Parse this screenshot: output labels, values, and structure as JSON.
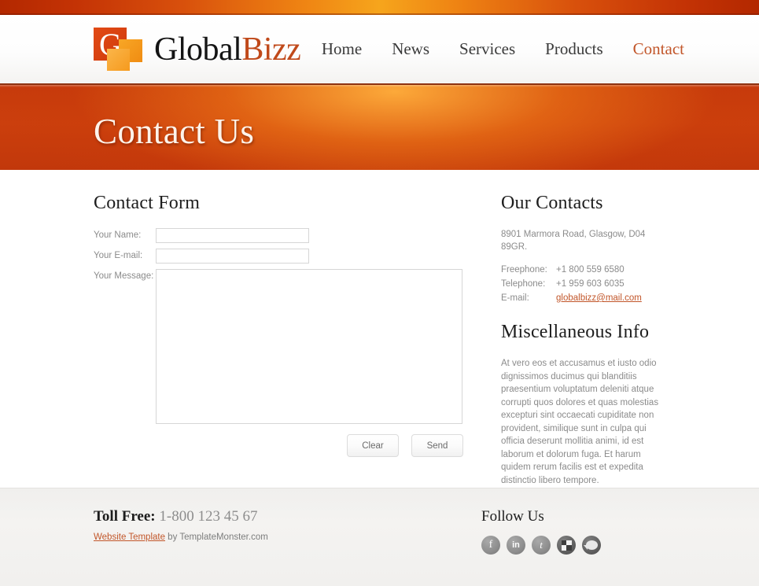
{
  "site": {
    "logo_primary": "Global",
    "logo_accent": "Bizz",
    "logo_letter": "G"
  },
  "nav": {
    "items": [
      {
        "label": "Home",
        "active": false
      },
      {
        "label": "News",
        "active": false
      },
      {
        "label": "Services",
        "active": false
      },
      {
        "label": "Products",
        "active": false
      },
      {
        "label": "Contact",
        "active": true
      }
    ]
  },
  "banner": {
    "title": "Contact Us"
  },
  "contact_form": {
    "title": "Contact Form",
    "fields": [
      {
        "label": "Your Name:",
        "value": "",
        "placeholder": ""
      },
      {
        "label": "Your E-mail:",
        "value": "",
        "placeholder": ""
      },
      {
        "label": "Your Message:",
        "value": "",
        "placeholder": ""
      }
    ],
    "clear_label": "Clear",
    "send_label": "Send"
  },
  "our_contacts": {
    "title": "Our Contacts",
    "address": "8901 Marmora Road, Glasgow, D04 89GR.",
    "rows": [
      {
        "key": "Freephone:",
        "value": "+1 800 559 6580",
        "is_link": false
      },
      {
        "key": "Telephone:",
        "value": "+1 959 603 6035",
        "is_link": false
      },
      {
        "key": "E-mail:",
        "value": "globalbizz@mail.com",
        "is_link": true
      }
    ]
  },
  "misc_info": {
    "title": "Miscellaneous Info",
    "body": "At vero eos et accusamus et iusto odio dignissimos ducimus qui blanditiis praesentium voluptatum deleniti atque corrupti quos dolores et quas molestias excepturi sint occaecati cupiditate non provident, similique sunt in culpa qui officia deserunt mollitia animi, id est laborum et dolorum fuga. Et harum quidem rerum facilis est et expedita distinctio libero tempore."
  },
  "footer": {
    "toll_free_label": "Toll Free:",
    "toll_free_number": "1-800 123 45 67",
    "credit_link": "Website Template",
    "credit_rest": " by TemplateMonster.com",
    "follow_title": "Follow Us",
    "social": [
      {
        "name": "facebook-icon",
        "glyph": "f"
      },
      {
        "name": "linkedin-icon",
        "glyph": "in"
      },
      {
        "name": "twitter-icon",
        "glyph": "t"
      },
      {
        "name": "delicious-icon",
        "glyph": ""
      },
      {
        "name": "chat-icon",
        "glyph": ""
      }
    ]
  },
  "colors": {
    "accent_orange": "#c2562a",
    "banner_red": "#c63a0c",
    "top_bar_amber": "#f6a51c",
    "logo_red": "#cf3a0c"
  }
}
